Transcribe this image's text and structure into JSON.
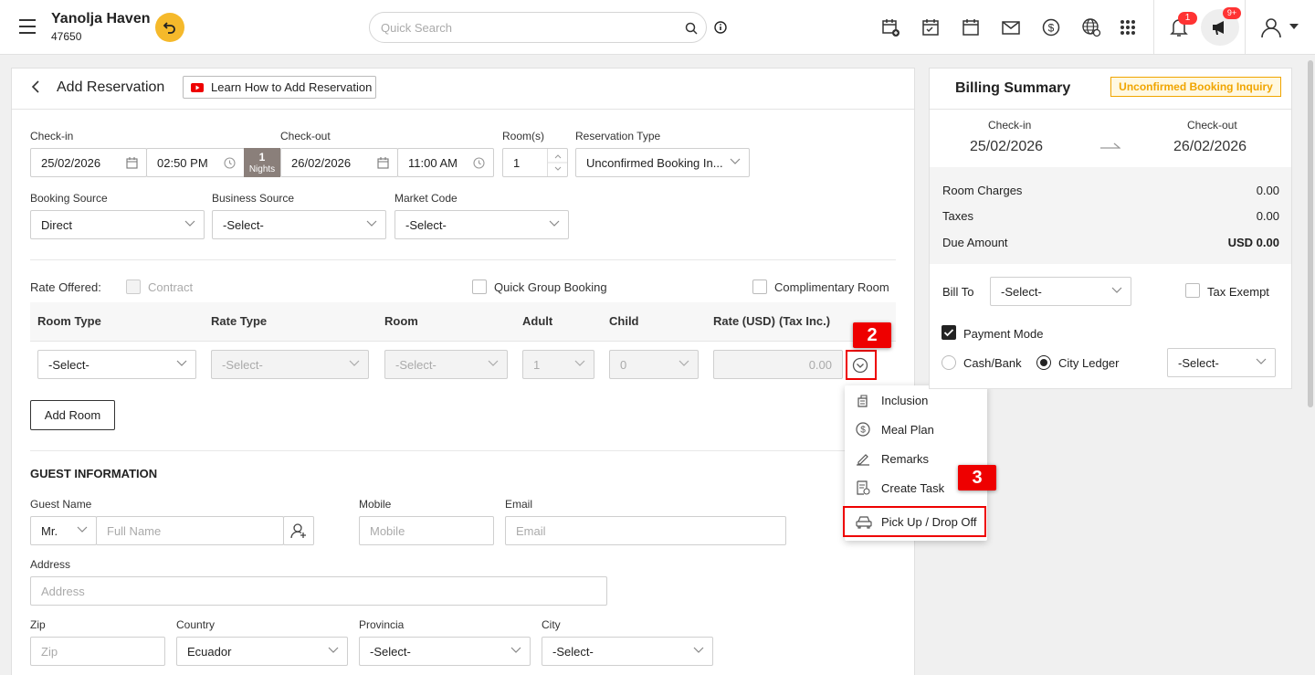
{
  "header": {
    "hotel_name": "Yanolja Haven",
    "hotel_id": "47650",
    "search_placeholder": "Quick Search",
    "notification_count": "1",
    "announcement_count": "9+"
  },
  "page": {
    "title": "Add Reservation",
    "learn_label": "Learn How to Add Reservation"
  },
  "stay": {
    "checkin_label": "Check-in",
    "checkin_date": "25/02/2026",
    "checkin_time": "02:50 PM",
    "nights_count": "1",
    "nights_label": "Nights",
    "checkout_label": "Check-out",
    "checkout_date": "26/02/2026",
    "checkout_time": "11:00 AM",
    "rooms_label": "Room(s)",
    "rooms_value": "1",
    "type_label": "Reservation Type",
    "type_value": "Unconfirmed Booking In..."
  },
  "source": {
    "booking_label": "Booking Source",
    "booking_value": "Direct",
    "business_label": "Business Source",
    "business_value": "-Select-",
    "market_label": "Market Code",
    "market_value": "-Select-"
  },
  "rate": {
    "offered_label": "Rate Offered:",
    "contract_label": "Contract",
    "quick_group_label": "Quick Group Booking",
    "complimentary_label": "Complimentary Room",
    "headers": [
      "Room Type",
      "Rate Type",
      "Room",
      "Adult",
      "Child",
      "Rate (USD)",
      "(Tax Inc.)"
    ],
    "row": {
      "room_type": "-Select-",
      "rate_type": "-Select-",
      "room": "-Select-",
      "adult": "1",
      "child": "0",
      "rate": "0.00"
    },
    "add_room_label": "Add Room"
  },
  "menu": {
    "items": [
      "Inclusion",
      "Meal Plan",
      "Remarks",
      "Create Task",
      "Pick Up / Drop Off"
    ]
  },
  "callouts": {
    "step2": "2",
    "step3": "3"
  },
  "guest": {
    "section_title": "GUEST INFORMATION",
    "name_label": "Guest Name",
    "salutation": "Mr.",
    "fullname_placeholder": "Full Name",
    "mobile_label": "Mobile",
    "mobile_placeholder": "Mobile",
    "email_label": "Email",
    "email_placeholder": "Email",
    "address_label": "Address",
    "address_placeholder": "Address",
    "zip_label": "Zip",
    "zip_placeholder": "Zip",
    "country_label": "Country",
    "country_value": "Ecuador",
    "province_label": "Provincia",
    "province_value": "-Select-",
    "city_label": "City",
    "city_value": "-Select-"
  },
  "billing": {
    "title": "Billing Summary",
    "badge": "Unconfirmed Booking Inquiry",
    "checkin_label": "Check-in",
    "checkin_date": "25/02/2026",
    "checkout_label": "Check-out",
    "checkout_date": "26/02/2026",
    "room_charges_label": "Room Charges",
    "room_charges_value": "0.00",
    "taxes_label": "Taxes",
    "taxes_value": "0.00",
    "due_label": "Due Amount",
    "due_value": "USD 0.00",
    "bill_to_label": "Bill To",
    "bill_to_value": "-Select-",
    "tax_exempt_label": "Tax Exempt",
    "payment_mode_label": "Payment Mode",
    "cash_label": "Cash/Bank",
    "city_ledger_label": "City Ledger",
    "ledger_value": "-Select-"
  },
  "colors": {
    "accent": "#f5b92b",
    "callout": "#e00000",
    "nights_bg": "#8a7f7a",
    "badge_text": "#f0a500"
  }
}
